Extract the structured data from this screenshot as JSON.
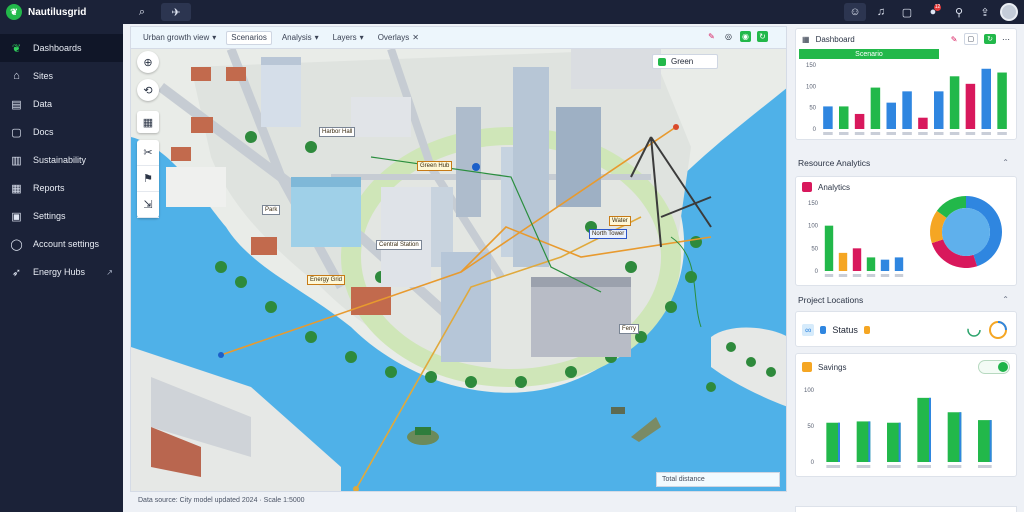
{
  "app": {
    "name": "Nautilusgrid"
  },
  "topbar": {
    "icons": [
      "search-icon",
      "pin-icon"
    ],
    "right_icons": [
      "support-icon",
      "bell-icon",
      "grid-icon",
      "notification-icon",
      "signal-icon",
      "share-icon"
    ],
    "notification_count": "12"
  },
  "sidebar": {
    "items": [
      {
        "label": "Dashboards",
        "icon": "leaf-icon"
      },
      {
        "label": "Sites",
        "icon": "home-icon"
      },
      {
        "label": "Data",
        "icon": "folder-icon"
      },
      {
        "label": "Docs",
        "icon": "square-icon"
      },
      {
        "label": "Sustainability",
        "icon": "bar-chart-icon"
      },
      {
        "label": "Reports",
        "icon": "document-icon"
      },
      {
        "label": "Settings",
        "icon": "calendar-icon"
      },
      {
        "label": "Account settings",
        "icon": "circle-icon"
      },
      {
        "label": "Energy Hubs",
        "icon": "bolt-icon"
      }
    ]
  },
  "map": {
    "toolbar": [
      {
        "label": "Urban growth view",
        "boxed": false
      },
      {
        "label": "Scenarios",
        "boxed": true
      },
      {
        "label": "Analysis",
        "boxed": false
      },
      {
        "label": "Layers",
        "boxed": false
      },
      {
        "label": "Overlays",
        "boxed": false
      }
    ],
    "layer_pill": "Green",
    "markers": [
      "Harbor Hall",
      "Central Station",
      "Energy Grid",
      "Water",
      "North Tower",
      "Ferry",
      "Park",
      "Green Hub"
    ],
    "legend": "Total distance",
    "status": "Data source: City model updated 2024 · Scale 1:5000"
  },
  "right": {
    "card1": {
      "title": "Dashboard",
      "tab": "Scenario"
    },
    "section1": "Resource Analytics",
    "card2": {
      "title": "Analytics"
    },
    "section2": "Project Locations",
    "card3": {
      "title": "Status"
    },
    "card4": {
      "title": "Savings"
    }
  },
  "colors": {
    "accent": "#22b84a",
    "blue": "#2f86e0",
    "magenta": "#d8185c",
    "orange": "#f5a623",
    "navy": "#1b2238"
  },
  "chart_data": [
    {
      "type": "bar",
      "title": "",
      "categories": [
        "1",
        "2",
        "3",
        "4",
        "5",
        "6",
        "7",
        "8",
        "9",
        "10",
        "11",
        "12"
      ],
      "series": [
        {
          "values": [
            60,
            60,
            40,
            110,
            70,
            100,
            30,
            100,
            140,
            120,
            160,
            150
          ]
        }
      ],
      "colors": [
        "#2f86e0",
        "#22b84a",
        "#d8185c",
        "#22b84a",
        "#2f86e0",
        "#2f86e0",
        "#d8185c",
        "#2f86e0",
        "#22b84a",
        "#d8185c",
        "#2f86e0",
        "#22b84a"
      ],
      "yticks": [
        "150",
        "100",
        "50",
        "0"
      ],
      "ylim": [
        0,
        170
      ]
    },
    {
      "type": "bar",
      "title": "",
      "categories": [
        "1",
        "2",
        "3",
        "4",
        "5",
        "6"
      ],
      "values": [
        100,
        40,
        50,
        30,
        25,
        30
      ],
      "colors": [
        "#22b84a",
        "#f5a623",
        "#d8185c",
        "#22b84a",
        "#2f86e0",
        "#2f86e0"
      ],
      "yticks": [
        "150",
        "100",
        "50",
        "0"
      ],
      "ylim": [
        0,
        150
      ]
    },
    {
      "type": "pie",
      "title": "",
      "slices": [
        {
          "value": 45,
          "color": "#2f86e0"
        },
        {
          "value": 25,
          "color": "#d8185c"
        },
        {
          "value": 15,
          "color": "#f5a623"
        },
        {
          "value": 15,
          "color": "#22b84a"
        }
      ]
    },
    {
      "type": "bar",
      "title": "",
      "categories": [
        "1",
        "2",
        "3",
        "4",
        "5",
        "6"
      ],
      "values": [
        60,
        62,
        60,
        98,
        76,
        64
      ],
      "yticks": [
        "100",
        "50",
        "0"
      ],
      "ylim": [
        0,
        110
      ]
    }
  ]
}
